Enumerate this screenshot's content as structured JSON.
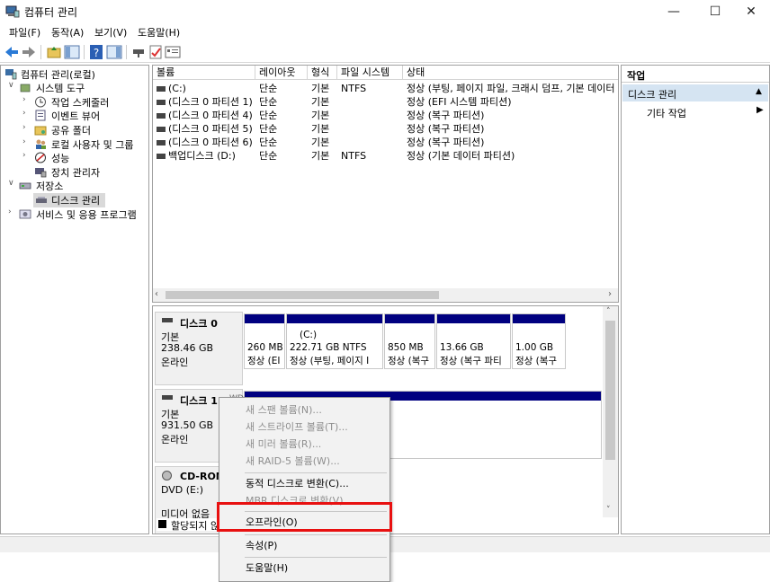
{
  "window": {
    "title": "컴퓨터 관리",
    "controls": [
      "—",
      "☐",
      "✕"
    ]
  },
  "menu": [
    "파일(F)",
    "동작(A)",
    "보기(V)",
    "도움말(H)"
  ],
  "tree": {
    "root": "컴퓨터 관리(로컬)",
    "system_tools": "시스템 도구",
    "task_scheduler": "작업 스케줄러",
    "event_viewer": "이벤트 뷰어",
    "shared_folders": "공유 폴더",
    "local_users": "로컬 사용자 및 그룹",
    "performance": "성능",
    "device_manager": "장치 관리자",
    "storage": "저장소",
    "disk_management": "디스크 관리",
    "services": "서비스 및 응용 프로그램"
  },
  "volumes": {
    "columns": [
      "볼륨",
      "레이아웃",
      "형식",
      "파일 시스템",
      "상태"
    ],
    "rows": [
      [
        "(C:)",
        "단순",
        "기본",
        "NTFS",
        "정상 (부팅, 페이지 파일, 크래시 덤프, 기본 데이터"
      ],
      [
        "(디스크 0 파티션 1)",
        "단순",
        "기본",
        "",
        "정상 (EFI 시스템 파티션)"
      ],
      [
        "(디스크 0 파티션 4)",
        "단순",
        "기본",
        "",
        "정상 (복구 파티션)"
      ],
      [
        "(디스크 0 파티션 5)",
        "단순",
        "기본",
        "",
        "정상 (복구 파티션)"
      ],
      [
        "(디스크 0 파티션 6)",
        "단순",
        "기본",
        "",
        "정상 (복구 파티션)"
      ],
      [
        "백업디스크 (D:)",
        "단순",
        "기본",
        "NTFS",
        "정상 (기본 데이터 파티션)"
      ]
    ]
  },
  "disks": {
    "disk0": {
      "name": "디스크 0",
      "type": "기본",
      "size": "238.46 GB",
      "status": "온라인",
      "partitions": [
        {
          "title": "",
          "size": "260 MB",
          "status": "정상 (EI"
        },
        {
          "title": "(C:)",
          "size": "222.71 GB NTFS",
          "status": "정상 (부팅, 페이지 I"
        },
        {
          "title": "",
          "size": "850 MB",
          "status": "정상 (복구"
        },
        {
          "title": "",
          "size": "13.66 GB",
          "status": "정상 (복구 파티"
        },
        {
          "title": "",
          "size": "1.00 GB",
          "status": "정상 (복구"
        }
      ]
    },
    "disk1": {
      "name": "디스크 1",
      "name_suffix": "WD",
      "type": "기본",
      "size": "931.50 GB",
      "status": "온라인"
    },
    "cdrom": {
      "name": "CD-ROM",
      "device": "DVD (E:)",
      "status": "미디어 없음"
    },
    "legend_unallocated": "할당되지 않음"
  },
  "actions": {
    "header": "작업",
    "section": "디스크 관리",
    "more": "기타 작업"
  },
  "context_menu": [
    {
      "label": "새 스팬 볼륨(N)...",
      "enabled": false
    },
    {
      "label": "새 스트라이프 볼륨(T)...",
      "enabled": false
    },
    {
      "label": "새 미러 볼륨(R)...",
      "enabled": false
    },
    {
      "label": "새 RAID-5 볼륨(W)...",
      "enabled": false
    },
    {
      "label": "동적 디스크로 변환(C)...",
      "enabled": true
    },
    {
      "label": "MBR 디스크로 변환(V)",
      "enabled": false
    },
    {
      "label": "오프라인(O)",
      "enabled": true
    },
    {
      "label": "속성(P)",
      "enabled": true
    },
    {
      "label": "도움말(H)",
      "enabled": true
    }
  ],
  "colors": {
    "partition_bar": "#000080",
    "highlight": "#e81010",
    "selected_bg": "#d9d9d9",
    "actions_header_bg": "#d5e4f2"
  }
}
